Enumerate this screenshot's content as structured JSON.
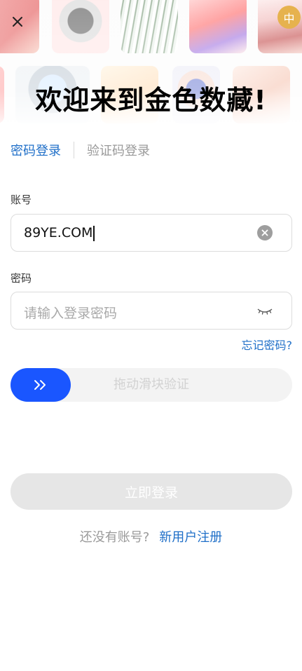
{
  "header": {
    "close_icon": "close-icon",
    "language_label": "中",
    "language_color": "#e6b24e"
  },
  "banner": {
    "welcome_text": "欢迎来到金色数藏!"
  },
  "tabs": [
    {
      "label": "密码登录",
      "active": true
    },
    {
      "label": "验证码登录",
      "active": false
    }
  ],
  "account": {
    "label": "账号",
    "value": "89YE.COM"
  },
  "password": {
    "label": "密码",
    "placeholder": "请输入登录密码"
  },
  "forgot_label": "忘记密码?",
  "slider": {
    "text": "拖动滑块验证",
    "handle_color": "#1a56ff"
  },
  "login_button": "立即登录",
  "register": {
    "question": "还没有账号?",
    "link": "新用户注册"
  },
  "colors": {
    "accent": "#1f6fc8",
    "disabled_button": "#e6e6e6"
  }
}
